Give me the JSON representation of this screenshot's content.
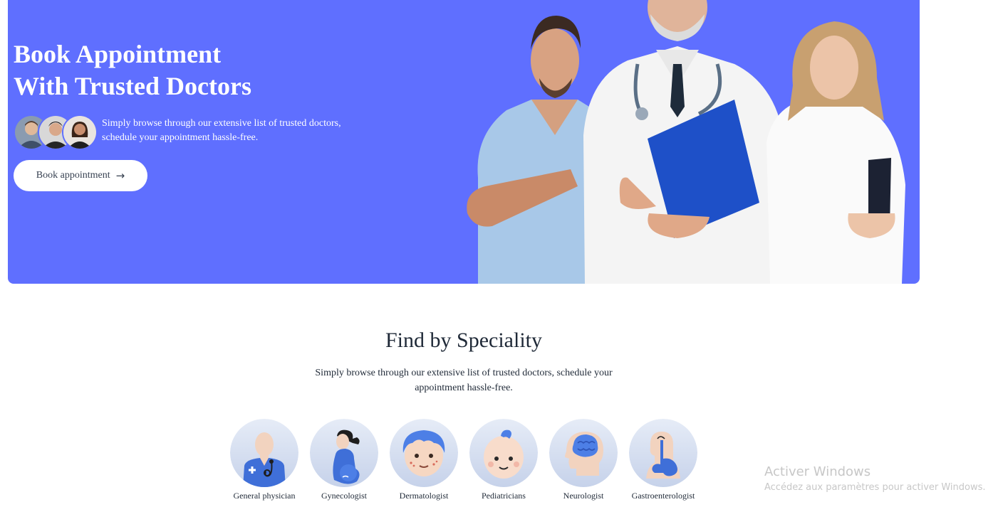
{
  "hero": {
    "title_line1": "Book Appointment",
    "title_line2": "With Trusted Doctors",
    "subtitle_line1": "Simply browse through our extensive list of trusted doctors,",
    "subtitle_line2": "schedule your appointment hassle-free.",
    "button_label": "Book appointment",
    "button_icon": "arrow-right-icon",
    "background_color": "#5f6fff"
  },
  "speciality": {
    "title": "Find by Speciality",
    "subtitle": "Simply browse through our extensive list of trusted doctors, schedule your appointment hassle-free.",
    "items": [
      {
        "label": "General physician",
        "icon": "general-physician-icon"
      },
      {
        "label": "Gynecologist",
        "icon": "gynecologist-icon"
      },
      {
        "label": "Dermatologist",
        "icon": "dermatologist-icon"
      },
      {
        "label": "Pediatricians",
        "icon": "pediatricians-icon"
      },
      {
        "label": "Neurologist",
        "icon": "neurologist-icon"
      },
      {
        "label": "Gastroenterologist",
        "icon": "gastroenterologist-icon"
      }
    ]
  },
  "watermark": {
    "title": "Activer Windows",
    "subtitle": "Accédez aux paramètres pour activer Windows."
  }
}
